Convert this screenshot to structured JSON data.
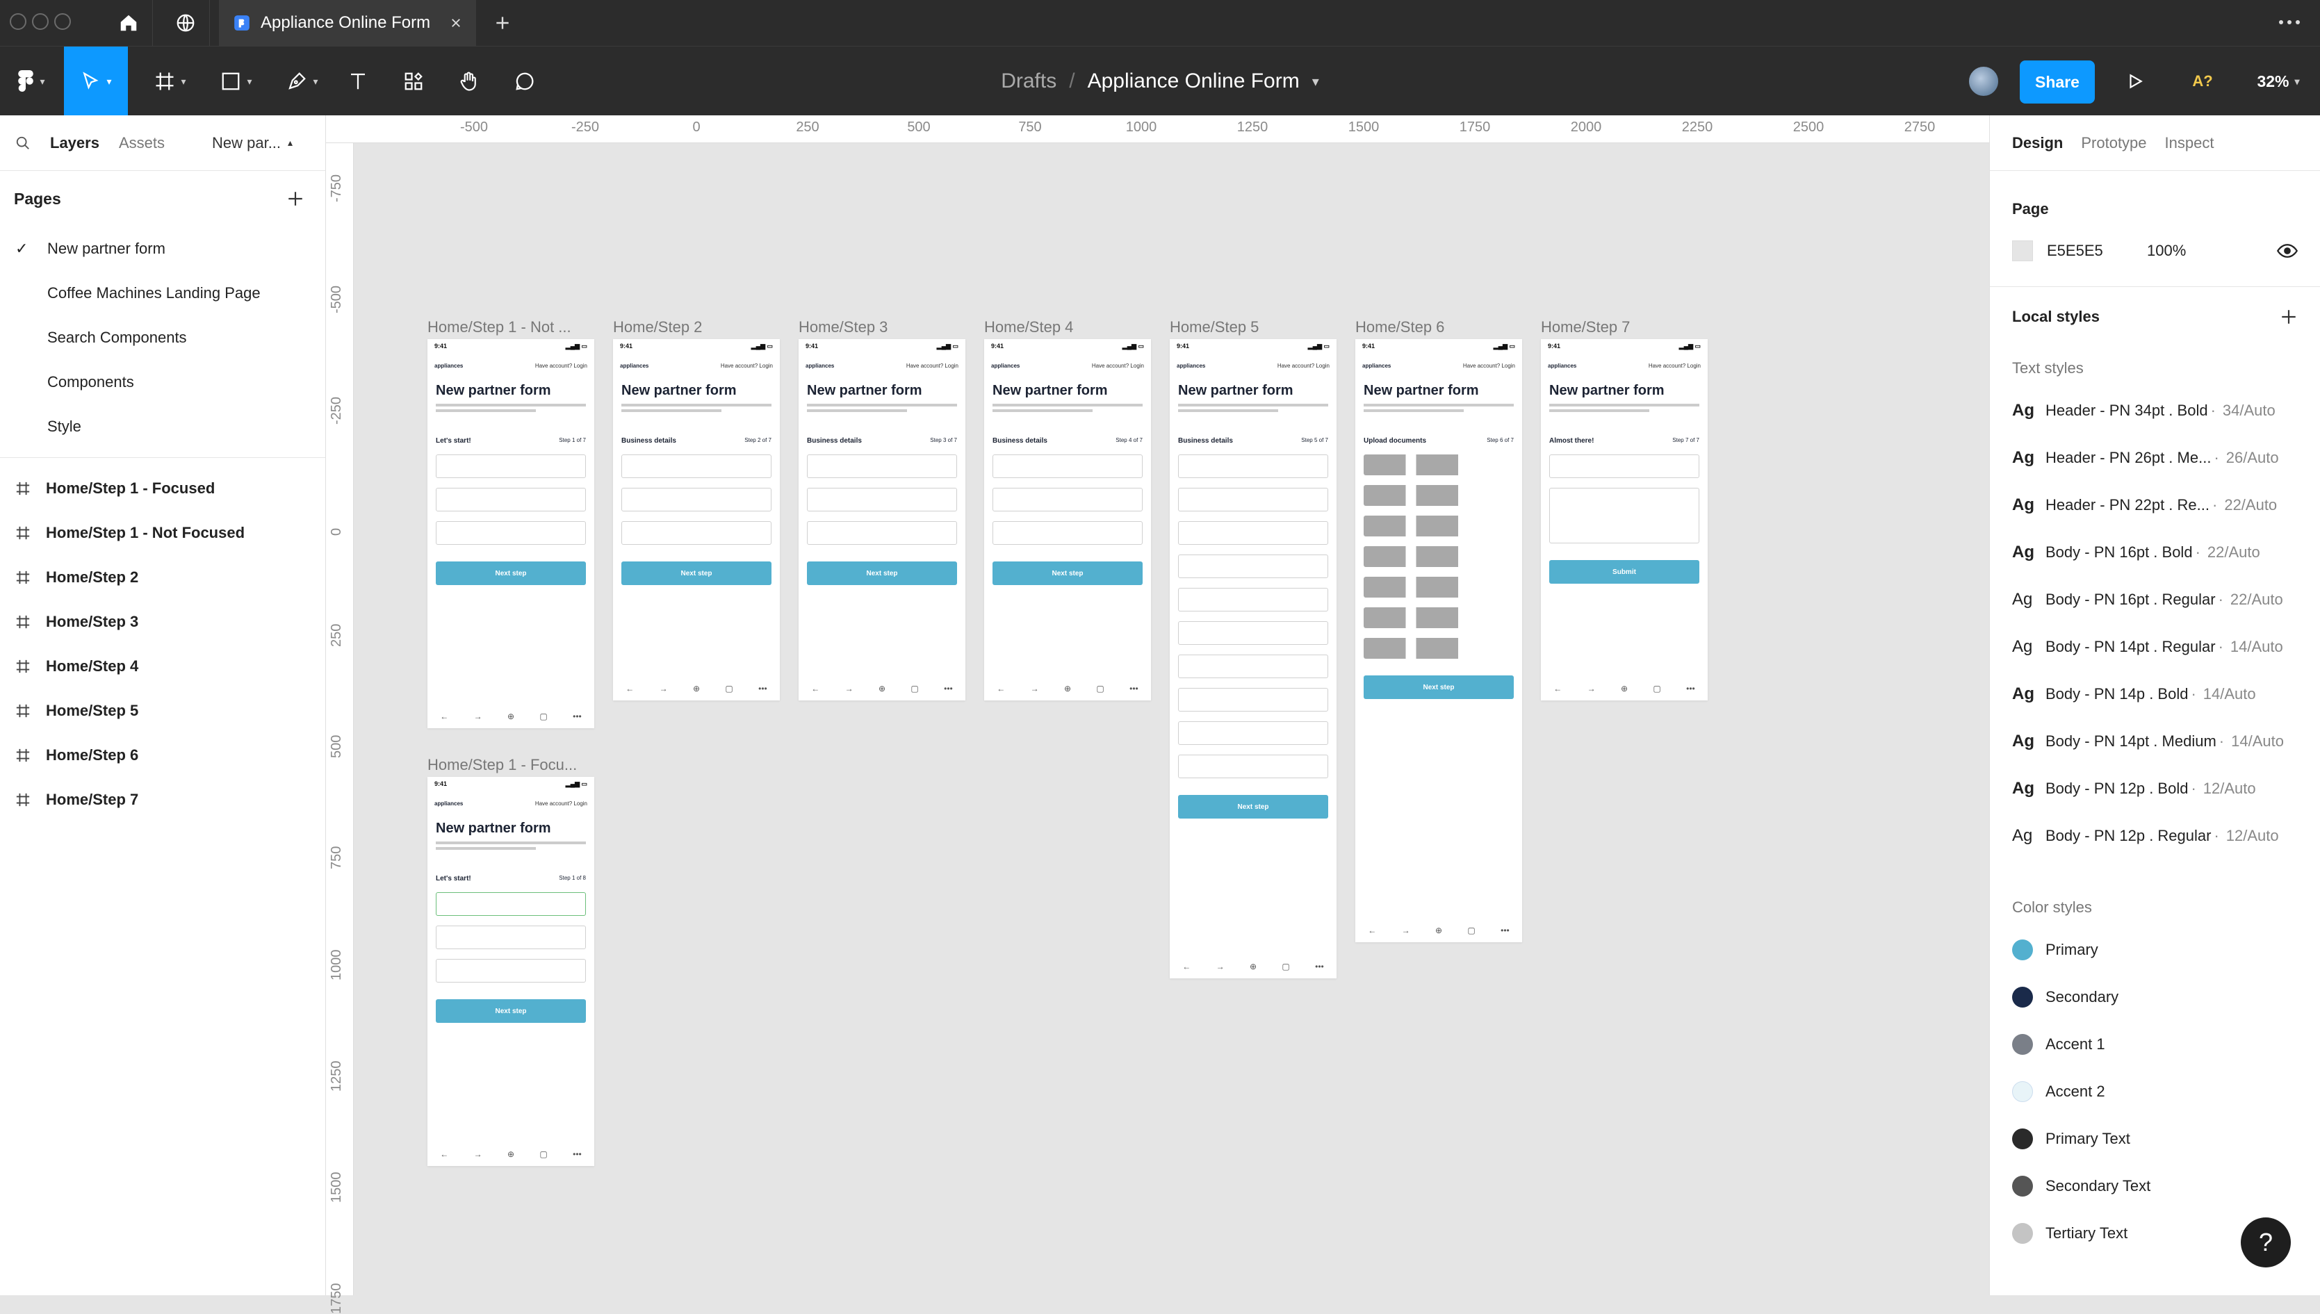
{
  "window": {
    "tab_title": "Appliance Online Form"
  },
  "toolbar": {
    "breadcrumb_root": "Drafts",
    "breadcrumb_sep": "/",
    "file_name": "Appliance Online Form",
    "share_label": "Share",
    "font_warning": "A?",
    "zoom": "32%",
    "colors": {
      "accent": "#0d99ff",
      "dark": "#2c2c2c"
    }
  },
  "left_panel": {
    "tabs": [
      "Layers",
      "Assets",
      "New par..."
    ],
    "pages_title": "Pages",
    "pages": [
      {
        "name": "New partner form",
        "current": true
      },
      {
        "name": "Coffee Machines Landing Page"
      },
      {
        "name": "Search Components"
      },
      {
        "name": "Components"
      },
      {
        "name": "Style"
      }
    ],
    "layers": [
      "Home/Step 1 - Focused",
      "Home/Step 1 - Not Focused",
      "Home/Step 2",
      "Home/Step 3",
      "Home/Step 4",
      "Home/Step 5",
      "Home/Step 6",
      "Home/Step 7"
    ]
  },
  "rulers": {
    "x": [
      "-500",
      "-250",
      "0",
      "250",
      "500",
      "750",
      "1000",
      "1250",
      "1500",
      "1750",
      "2000",
      "2250",
      "2500",
      "2750"
    ],
    "y": [
      "-750",
      "-500",
      "-250",
      "0",
      "250",
      "500",
      "750",
      "1000",
      "1250",
      "1500",
      "1750"
    ]
  },
  "frames": [
    {
      "label": "Home/Step 1 - Not ...",
      "section": "Let's start!",
      "step": "Step 1 of 7",
      "button": "Next step"
    },
    {
      "label": "Home/Step 2",
      "section": "Business details",
      "step": "Step 2 of 7",
      "button": "Next step"
    },
    {
      "label": "Home/Step 3",
      "section": "Business details",
      "step": "Step 3 of 7",
      "button": "Next step"
    },
    {
      "label": "Home/Step 4",
      "section": "Business details",
      "step": "Step 4 of 7",
      "button": "Next step"
    },
    {
      "label": "Home/Step 5",
      "section": "Business details",
      "step": "Step 5 of 7",
      "button": "Next step"
    },
    {
      "label": "Home/Step 6",
      "section": "Upload documents",
      "step": "Step 6 of 7",
      "button": "Next step"
    },
    {
      "label": "Home/Step 7",
      "section": "Almost there!",
      "step": "Step 7 of 7",
      "button": "Submit"
    },
    {
      "label": "Home/Step 1 - Focu...",
      "section": "Let's start!",
      "step": "Step 1 of 8",
      "button": "Next step"
    }
  ],
  "phone": {
    "time": "9:41",
    "title": "New partner form",
    "account": "Have account? Login",
    "brand": "appliances"
  },
  "right_panel": {
    "tabs": [
      "Design",
      "Prototype",
      "Inspect"
    ],
    "page_title": "Page",
    "page_color": "E5E5E5",
    "page_opacity": "100%",
    "local_styles": "Local styles",
    "text_styles_title": "Text styles",
    "text_styles": [
      {
        "name": "Header - PN 34pt . Bold",
        "meta": "34/Auto",
        "weight": "bold"
      },
      {
        "name": "Header - PN 26pt . Me...",
        "meta": "26/Auto",
        "weight": "bold"
      },
      {
        "name": "Header - PN 22pt . Re...",
        "meta": "22/Auto",
        "weight": "bold"
      },
      {
        "name": "Body - PN 16pt . Bold",
        "meta": "22/Auto",
        "weight": "bold"
      },
      {
        "name": "Body - PN 16pt . Regular",
        "meta": "22/Auto",
        "weight": "normal"
      },
      {
        "name": "Body - PN 14pt . Regular",
        "meta": "14/Auto",
        "weight": "normal"
      },
      {
        "name": "Body - PN 14p . Bold",
        "meta": "14/Auto",
        "weight": "bold"
      },
      {
        "name": "Body - PN 14pt . Medium",
        "meta": "14/Auto",
        "weight": "bold"
      },
      {
        "name": "Body - PN 12p . Bold",
        "meta": "12/Auto",
        "weight": "bold"
      },
      {
        "name": "Body - PN 12p . Regular",
        "meta": "12/Auto",
        "weight": "normal"
      }
    ],
    "color_styles_title": "Color styles",
    "color_styles": [
      {
        "name": "Primary",
        "color": "#53b0cf"
      },
      {
        "name": "Secondary",
        "color": "#1a2a4a"
      },
      {
        "name": "Accent 1",
        "color": "#7a7f88"
      },
      {
        "name": "Accent 2",
        "color": "#e8f4f8"
      },
      {
        "name": "Primary Text",
        "color": "#2a2a2a"
      },
      {
        "name": "Secondary Text",
        "color": "#555555"
      },
      {
        "name": "Tertiary Text",
        "color": "#c4c4c4"
      }
    ]
  },
  "help": "?"
}
